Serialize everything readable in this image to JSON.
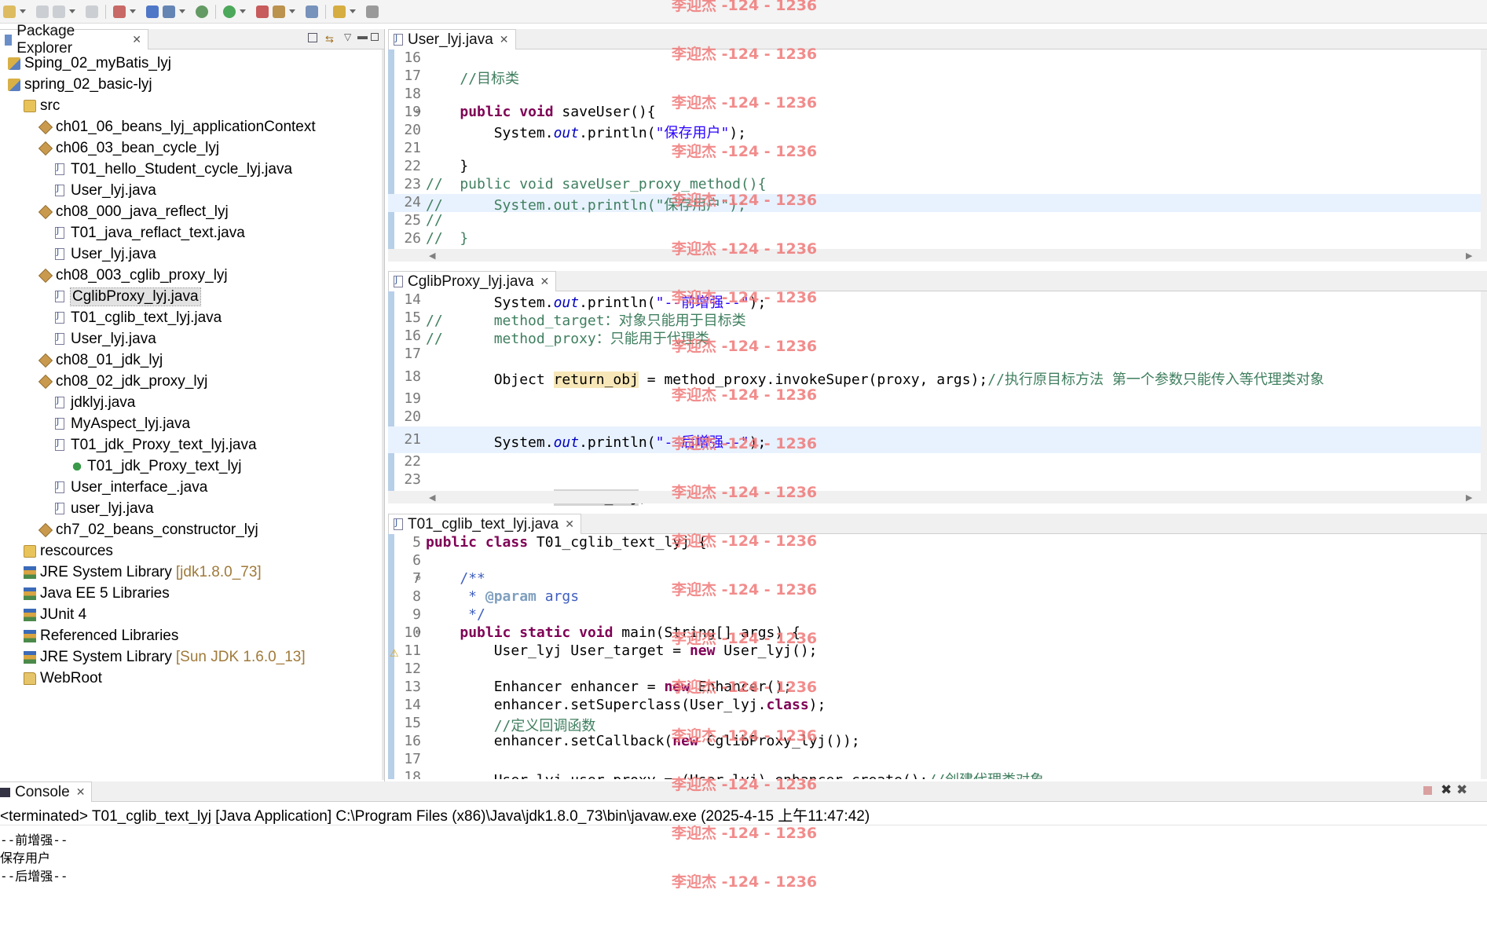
{
  "toolbar": {
    "icons": [
      "new-icon",
      "save-icon",
      "save-all-icon",
      "print-icon",
      "new-java-icon",
      "server-icon",
      "gear-icon",
      "debug-icon",
      "run-icon",
      "external-tools-icon",
      "open-type-icon",
      "search-icon",
      "back-icon",
      "forward-icon"
    ]
  },
  "package_explorer": {
    "title": "Package Explorer",
    "items": [
      {
        "label": "Sping_02_myBatis_lyj",
        "type": "project",
        "indent": 0
      },
      {
        "label": "spring_02_basic-lyj",
        "type": "project",
        "indent": 0
      },
      {
        "label": "src",
        "type": "src",
        "indent": 1
      },
      {
        "label": "ch01_06_beans_lyj_applicationContext",
        "type": "package",
        "indent": 2
      },
      {
        "label": "ch06_03_bean_cycle_lyj",
        "type": "package",
        "indent": 2
      },
      {
        "label": "T01_hello_Student_cycle_lyj.java",
        "type": "java",
        "indent": 3
      },
      {
        "label": "User_lyj.java",
        "type": "java",
        "indent": 3
      },
      {
        "label": "ch08_000_java_reflect_lyj",
        "type": "package",
        "indent": 2
      },
      {
        "label": "T01_java_reflact_text.java",
        "type": "java",
        "indent": 3
      },
      {
        "label": "User_lyj.java",
        "type": "java",
        "indent": 3
      },
      {
        "label": "ch08_003_cglib_proxy_lyj",
        "type": "package",
        "indent": 2
      },
      {
        "label": "CglibProxy_lyj.java",
        "type": "java",
        "indent": 3,
        "selected": true
      },
      {
        "label": "T01_cglib_text_lyj.java",
        "type": "java",
        "indent": 3
      },
      {
        "label": "User_lyj.java",
        "type": "java",
        "indent": 3
      },
      {
        "label": "ch08_01_jdk_lyj",
        "type": "package",
        "indent": 2
      },
      {
        "label": "ch08_02_jdk_proxy_lyj",
        "type": "package",
        "indent": 2
      },
      {
        "label": "jdklyj.java",
        "type": "java",
        "indent": 3
      },
      {
        "label": "MyAspect_lyj.java",
        "type": "java",
        "indent": 3
      },
      {
        "label": "T01_jdk_Proxy_text_lyj.java",
        "type": "java",
        "indent": 3
      },
      {
        "label": "T01_jdk_Proxy_text_lyj",
        "type": "class",
        "indent": 4
      },
      {
        "label": "User_interface_.java",
        "type": "java",
        "indent": 3
      },
      {
        "label": "user_lyj.java",
        "type": "java",
        "indent": 3
      },
      {
        "label": "ch7_02_beans_constructor_lyj",
        "type": "package",
        "indent": 2
      },
      {
        "label": "rescources",
        "type": "src",
        "indent": 1
      },
      {
        "label": "JRE System Library",
        "extra": "[jdk1.8.0_73]",
        "type": "lib",
        "indent": 1
      },
      {
        "label": "Java EE 5 Libraries",
        "type": "lib",
        "indent": 1
      },
      {
        "label": "JUnit 4",
        "type": "lib",
        "indent": 1
      },
      {
        "label": "Referenced Libraries",
        "type": "lib",
        "indent": 1
      },
      {
        "label": "JRE System Library",
        "extra": "[Sun JDK 1.6.0_13]",
        "type": "lib",
        "indent": 1
      },
      {
        "label": "WebRoot",
        "type": "folder",
        "indent": 1
      }
    ]
  },
  "editors": [
    {
      "tab": "User_lyj.java",
      "lines": [
        {
          "n": "16",
          "html": ""
        },
        {
          "n": "17",
          "html": "    <span class='cm'>//目标类</span>"
        },
        {
          "n": "18",
          "html": ""
        },
        {
          "n": "19",
          "fold": true,
          "html": "    <span class='kw'>public</span> <span class='kw'>void</span> saveUser(){"
        },
        {
          "n": "20",
          "html": "        System.<span class='fld'>out</span>.println(<span class='str'>\"保存用户\"</span>);"
        },
        {
          "n": "21",
          "html": ""
        },
        {
          "n": "22",
          "html": "    }"
        },
        {
          "n": "23",
          "html": "<span class='cm'>//  public void saveUser_proxy_method(){</span>"
        },
        {
          "n": "24",
          "hl": true,
          "html": "<span class='cm'>//      System.out.println(\"保存用户\");</span>"
        },
        {
          "n": "25",
          "html": "<span class='cm'>//</span>"
        },
        {
          "n": "26",
          "html": "<span class='cm'>//  }</span>"
        }
      ]
    },
    {
      "tab": "CglibProxy_lyj.java",
      "lines": [
        {
          "n": "14",
          "html": "        System.<span class='fld'>out</span>.println(<span class='str'>\"--前增强--\"</span>);"
        },
        {
          "n": "15",
          "html": "<span class='cm'>//      method_target：对象只能用于目标类</span>"
        },
        {
          "n": "16",
          "html": "<span class='cm'>//      method_proxy：只能用于代理类</span>"
        },
        {
          "n": "17",
          "html": ""
        },
        {
          "n": "18",
          "tall": true,
          "html": "        Object <span class='occ'>return_obj</span> = method_proxy.invokeSuper(proxy, args);<span class='cm'>//执行原目标方法 第一个参数只能传入等代理类对象</span>"
        },
        {
          "n": "19",
          "html": ""
        },
        {
          "n": "20",
          "html": ""
        },
        {
          "n": "21",
          "hl": true,
          "tall": true,
          "html": "        System.<span class='fld'>out</span>.println(<span class='str'>\"--后增强--\"</span>);"
        },
        {
          "n": "22",
          "html": ""
        },
        {
          "n": "23",
          "html": ""
        },
        {
          "n": "24",
          "html": "        <span class='kw'>return</span> <span class='occ2'>return_obj</span>;"
        }
      ]
    },
    {
      "tab": "T01_cglib_text_lyj.java",
      "lines": [
        {
          "n": "5",
          "html": "<span class='kw'>public</span> <span class='kw'>class</span> T01_cglib_text_lyj {"
        },
        {
          "n": "6",
          "html": ""
        },
        {
          "n": "7",
          "fold": true,
          "html": "    <span class='jd'>/**</span>"
        },
        {
          "n": "8",
          "html": "<span class='jd'>     * </span><span class='jdtag'>@param</span><span class='jd'> args</span>"
        },
        {
          "n": "9",
          "html": "<span class='jd'>     */</span>"
        },
        {
          "n": "10",
          "fold": true,
          "html": "    <span class='kw'>public</span> <span class='kw'>static</span> <span class='kw'>void</span> main(String[] args) {"
        },
        {
          "n": "11",
          "html": "        User_lyj User_target = <span class='kw'>new</span> User_lyj();"
        },
        {
          "n": "12",
          "html": ""
        },
        {
          "n": "13",
          "html": "        Enhancer enhancer = <span class='kw'>new</span> Enhancer();"
        },
        {
          "n": "14",
          "html": "        enhancer.setSuperclass(User_lyj.<span class='kw'>class</span>);"
        },
        {
          "n": "15",
          "html": "        <span class='cm'>//定义回调函数</span>"
        },
        {
          "n": "16",
          "html": "        enhancer.setCallback(<span class='kw'>new</span> CglibProxy_lyj());"
        },
        {
          "n": "17",
          "html": ""
        },
        {
          "n": "18",
          "html": "        User_lyj user_proxy = (User_lyj) enhancer.create();<span class='cm'>//创建代理类对象</span>"
        }
      ]
    }
  ],
  "console": {
    "title": "Console",
    "header": "<terminated> T01_cglib_text_lyj [Java Application] C:\\Program Files (x86)\\Java\\jdk1.8.0_73\\bin\\javaw.exe (2025-4-15 上午11:47:42)",
    "output": [
      "--前增强--",
      "保存用户",
      "--后增强--"
    ]
  },
  "watermark": "李迎杰 -124 - 1236"
}
